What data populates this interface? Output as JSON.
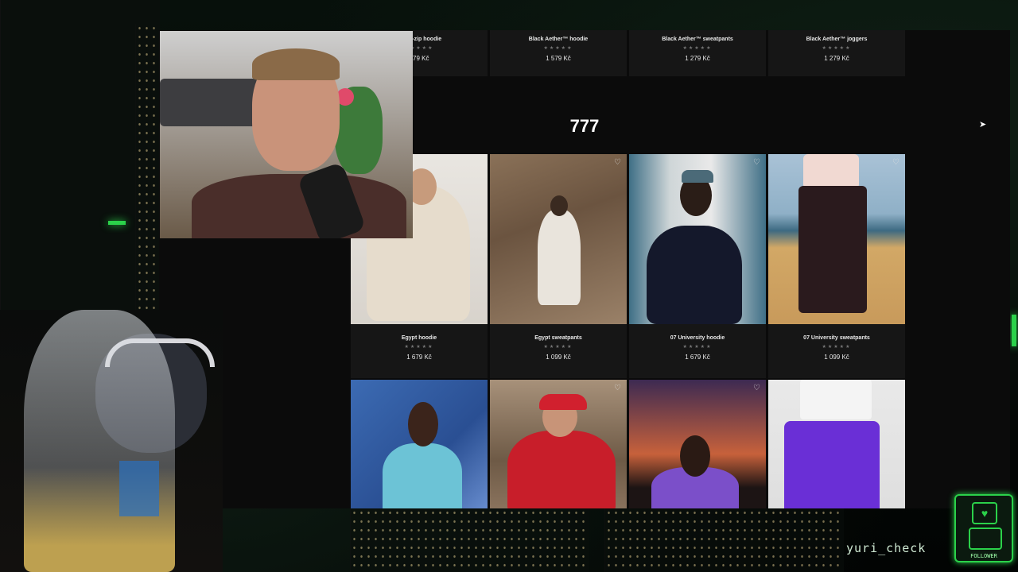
{
  "shop": {
    "top_row": [
      {
        "name": "™ full-zip hoodie",
        "stars": "★★★★★",
        "price": "679 Kč"
      },
      {
        "name": "Black Aether™ hoodie",
        "stars": "★★★★★",
        "price": "1 579 Kč"
      },
      {
        "name": "Black Aether™ sweatpants",
        "stars": "★★★★★",
        "price": "1 279 Kč"
      },
      {
        "name": "Black Aether™ joggers",
        "stars": "★★★★★",
        "price": "1 279 Kč"
      }
    ],
    "section_title": "777",
    "products": [
      {
        "name": "Egypt hoodie",
        "stars": "★★★★★",
        "price": "1 679 Kč"
      },
      {
        "name": "Egypt sweatpants",
        "stars": "★★★★★",
        "price": "1 099 Kč"
      },
      {
        "name": "07 University hoodie",
        "stars": "★★★★★",
        "price": "1 679 Kč"
      },
      {
        "name": "07 University sweatpants",
        "stars": "★★★★★",
        "price": "1 099 Kč"
      }
    ],
    "heart_icon": "♡"
  },
  "stream": {
    "username": "yuri_check",
    "follower_label": "FOLLOWER"
  },
  "colors": {
    "accent_green": "#2bd14a",
    "card_bg": "#161616",
    "page_bg": "#0b0b0b"
  }
}
